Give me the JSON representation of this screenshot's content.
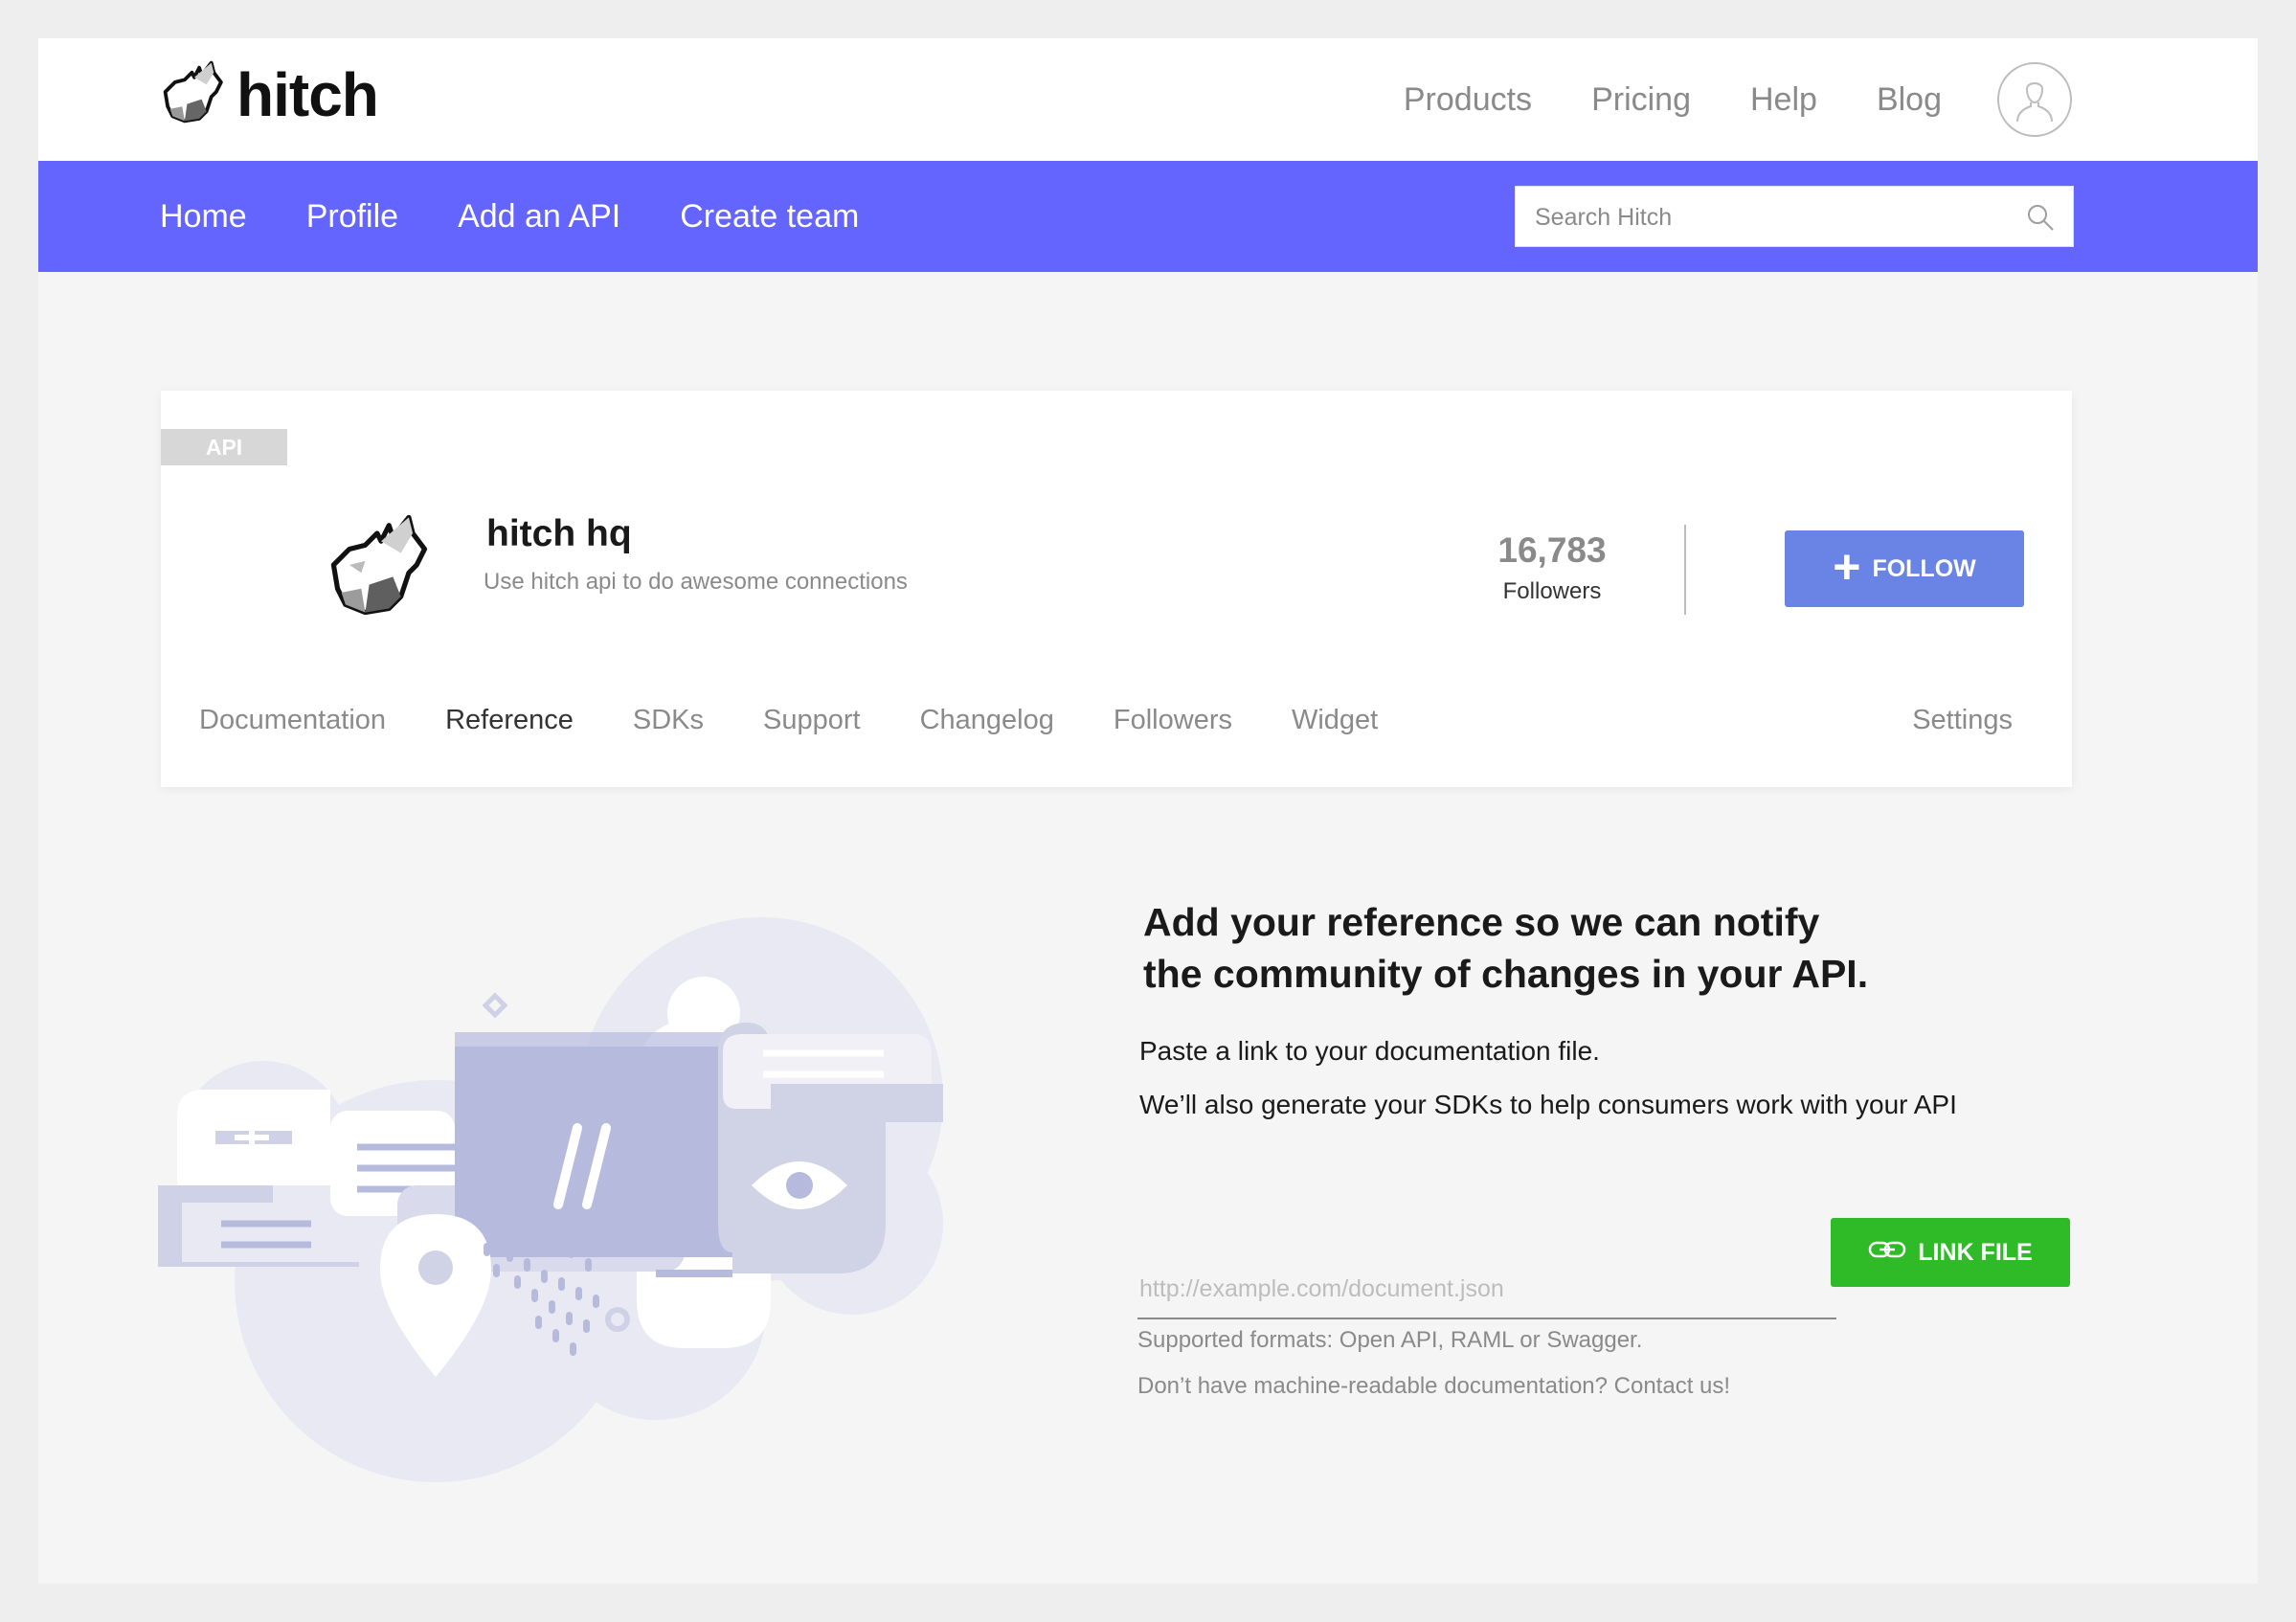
{
  "brand": {
    "name": "hitch"
  },
  "top_nav": {
    "links": [
      "Products",
      "Pricing",
      "Help",
      "Blog"
    ]
  },
  "main_nav": {
    "links": [
      "Home",
      "Profile",
      "Add an API",
      "Create team"
    ],
    "search_placeholder": "Search Hitch"
  },
  "api_card": {
    "badge": "API",
    "name": "hitch hq",
    "description": "Use hitch api to do awesome connections",
    "followers_count": "16,783",
    "followers_label": "Followers",
    "follow_button": "FOLLOW",
    "tabs": [
      "Documentation",
      "Reference",
      "SDKs",
      "Support",
      "Changelog",
      "Followers",
      "Widget"
    ],
    "active_tab": "Reference",
    "settings_tab": "Settings"
  },
  "reference": {
    "heading_line1": "Add your reference so we can notify",
    "heading_line2": "the community of changes in your API.",
    "para1": "Paste a link to your documentation file.",
    "para2": "We’ll also generate your SDKs to help consumers work with your API",
    "input_placeholder": "http://example.com/document.json",
    "link_button": "LINK FILE",
    "note1": "Supported formats: Open API, RAML or Swagger.",
    "note2": "Don’t have machine-readable documentation? Contact us!"
  },
  "colors": {
    "nav_purple": "#6464ff",
    "follow_blue": "#6a84e6",
    "link_green": "#2fba28",
    "illustration_purple": "#b6bbdd"
  },
  "icons": {
    "brand_logo": "wolf-icon",
    "search": "search-icon",
    "avatar": "user-icon",
    "follow": "plus-icon",
    "link": "link-icon"
  }
}
